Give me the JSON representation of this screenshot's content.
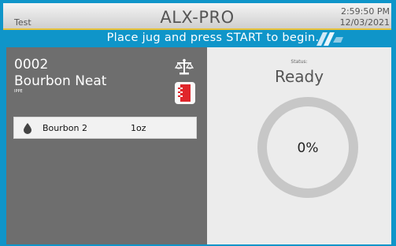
{
  "header": {
    "left_label": "Test",
    "title": "ALX-PRO",
    "time": "2:59:50 PM",
    "date": "12/03/2021"
  },
  "banner": {
    "message": "Place jug and press START to begin.",
    "logo_icon": "alx-stripes-logo"
  },
  "order": {
    "code": "0002",
    "drink_name": "Bourbon Neat",
    "sub_label": "IPPE",
    "ingredients": [
      {
        "name": "Bourbon 2",
        "amount": "1oz",
        "icon": "drop-icon"
      }
    ]
  },
  "icons": {
    "scale": "scale-icon",
    "dispense": "dispense-icon"
  },
  "status": {
    "label": "Status:",
    "value": "Ready",
    "progress_text": "0%",
    "progress_fraction": 0
  },
  "colors": {
    "accent": "#0f95c9",
    "left_panel": "#6e6e6e",
    "right_panel": "#ececec",
    "gauge_ring": "#c7c7c7",
    "dispense_red": "#e0262b",
    "header_underline": "#e8c23a"
  }
}
